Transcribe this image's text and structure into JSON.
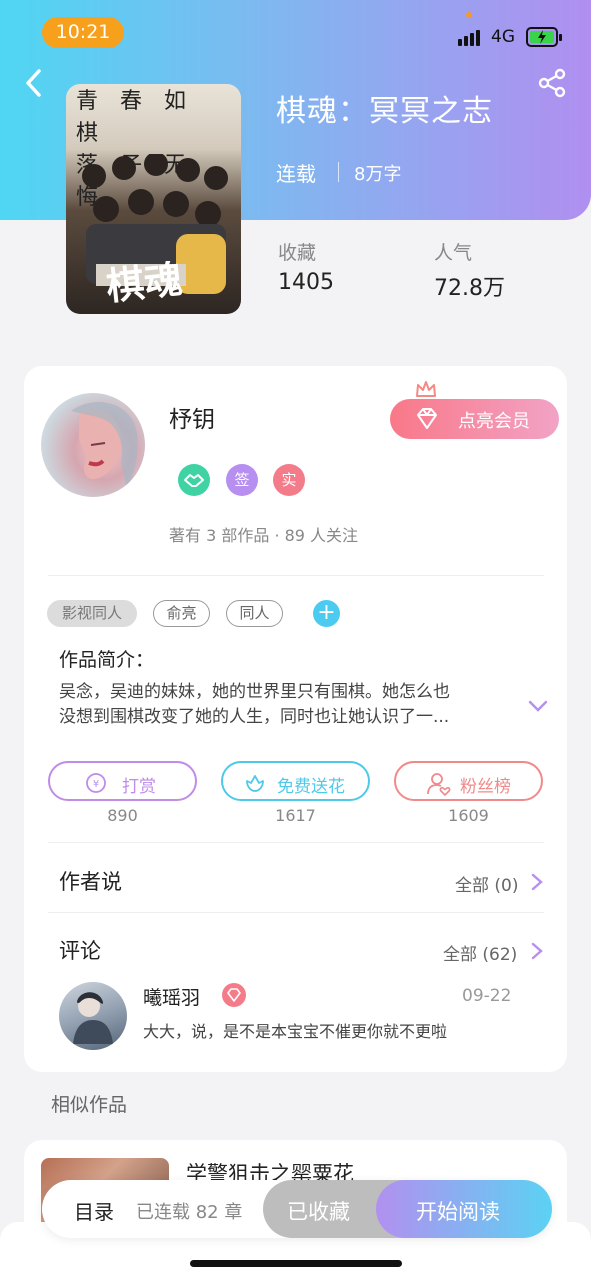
{
  "status_bar": {
    "time": "10:21",
    "network": "4G"
  },
  "book": {
    "title": "棋魂：冥冥之志",
    "status": "连载",
    "words": "8万字",
    "cover_poem": [
      "青",
      "春",
      "如",
      "棋",
      "落",
      "子",
      "无",
      "悔"
    ],
    "cover_title": "棋魂",
    "stats": {
      "collect_label": "收藏",
      "collect_value": "1405",
      "popularity_label": "人气",
      "popularity_value": "72.8万"
    }
  },
  "author": {
    "name": "杼钥",
    "vip_button": "点亮会员",
    "badges": [
      {
        "icon": "handshake-icon",
        "color": "#3fd3a3"
      },
      {
        "label": "签",
        "color": "#b68ff0"
      },
      {
        "label": "实",
        "color": "#f47c8a"
      }
    ],
    "stats_text": "著有 3 部作品 · 89 人关注"
  },
  "tags": [
    "影视同人",
    "俞亮",
    "同人"
  ],
  "intro": {
    "title": "作品简介：",
    "line1": "吴念，吴迪的妹妹，她的世界里只有围棋。她怎么也",
    "line2": "没想到围棋改变了她的人生，同时也让她认识了一..."
  },
  "actions": [
    {
      "label": "打赏",
      "count": "890",
      "color": "#c08ce8"
    },
    {
      "label": "免费送花",
      "count": "1617",
      "color": "#4fc9ea"
    },
    {
      "label": "粉丝榜",
      "count": "1609",
      "color": "#f08a8a"
    }
  ],
  "author_says": {
    "title": "作者说",
    "more": "全部 (0)"
  },
  "comments": {
    "title": "评论",
    "more": "全部 (62)",
    "items": [
      {
        "user": "曦瑶羽",
        "date": "09-22",
        "text": "大大，说，是不是本宝宝不催更你就不更啦"
      }
    ]
  },
  "similar": {
    "title": "相似作品",
    "first_name": "学警狙击之罂粟花"
  },
  "bottom_bar": {
    "toc_label": "目录",
    "toc_count": "已连载 82 章",
    "collected_label": "已收藏",
    "read_label": "开始阅读"
  },
  "colors": {
    "gradient_start": "#4fd6f3",
    "gradient_end": "#b08ff0",
    "vip": "#f97888"
  }
}
